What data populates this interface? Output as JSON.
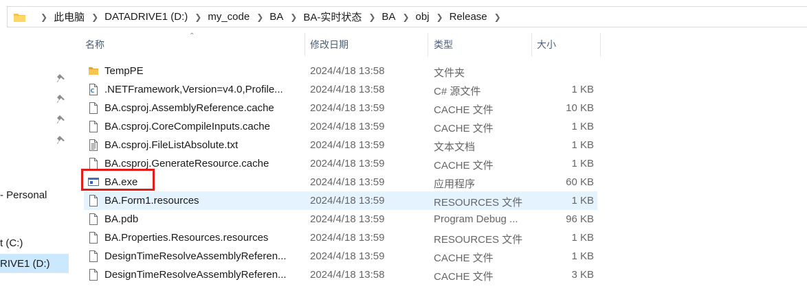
{
  "address": {
    "crumbs": [
      "此电脑",
      "DATADRIVE1 (D:)",
      "my_code",
      "BA",
      "BA-实时状态",
      "BA",
      "obj",
      "Release"
    ]
  },
  "nav": {
    "items": [
      "- Personal",
      "t (C:)",
      "RIVE1 (D:)"
    ]
  },
  "columns": {
    "name": "名称",
    "date": "修改日期",
    "type": "类型",
    "size": "大小"
  },
  "files": [
    {
      "name": "TempPE",
      "date": "2024/4/18 13:58",
      "type": "文件夹",
      "size": "",
      "icon": "folder-icon"
    },
    {
      "name": ".NETFramework,Version=v4.0,Profile...",
      "date": "2024/4/18 13:58",
      "type": "C# 源文件",
      "size": "1 KB",
      "icon": "csharp-file-icon"
    },
    {
      "name": "BA.csproj.AssemblyReference.cache",
      "date": "2024/4/18 13:59",
      "type": "CACHE 文件",
      "size": "10 KB",
      "icon": "file-icon"
    },
    {
      "name": "BA.csproj.CoreCompileInputs.cache",
      "date": "2024/4/18 13:59",
      "type": "CACHE 文件",
      "size": "1 KB",
      "icon": "file-icon"
    },
    {
      "name": "BA.csproj.FileListAbsolute.txt",
      "date": "2024/4/18 13:59",
      "type": "文本文档",
      "size": "1 KB",
      "icon": "text-file-icon"
    },
    {
      "name": "BA.csproj.GenerateResource.cache",
      "date": "2024/4/18 13:59",
      "type": "CACHE 文件",
      "size": "1 KB",
      "icon": "file-icon"
    },
    {
      "name": "BA.exe",
      "date": "2024/4/18 13:59",
      "type": "应用程序",
      "size": "60 KB",
      "icon": "exe-icon"
    },
    {
      "name": "BA.Form1.resources",
      "date": "2024/4/18 13:59",
      "type": "RESOURCES 文件",
      "size": "1 KB",
      "icon": "file-icon"
    },
    {
      "name": "BA.pdb",
      "date": "2024/4/18 13:59",
      "type": "Program Debug ...",
      "size": "96 KB",
      "icon": "file-icon"
    },
    {
      "name": "BA.Properties.Resources.resources",
      "date": "2024/4/18 13:59",
      "type": "RESOURCES 文件",
      "size": "1 KB",
      "icon": "file-icon"
    },
    {
      "name": "DesignTimeResolveAssemblyReferen...",
      "date": "2024/4/18 13:59",
      "type": "CACHE 文件",
      "size": "1 KB",
      "icon": "file-icon"
    },
    {
      "name": "DesignTimeResolveAssemblyReferen...",
      "date": "2024/4/18 13:58",
      "type": "CACHE 文件",
      "size": "3 KB",
      "icon": "file-icon"
    }
  ],
  "hover_row": "BA.Form1.resources",
  "highlighted_file": "BA.exe",
  "colors": {
    "highlight_border": "#e21b1b",
    "hover_bg": "#e5f3ff",
    "nav_selected_bg": "#cce8ff",
    "folder": "#f4c24d"
  }
}
